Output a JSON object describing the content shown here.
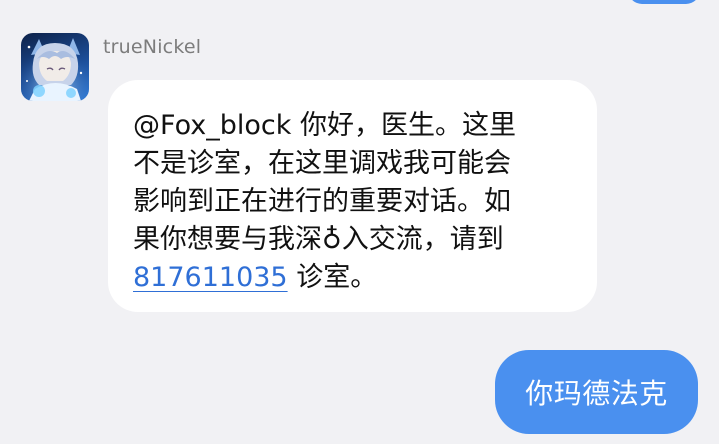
{
  "top_bubble": {
    "color": "#4a90ef"
  },
  "incoming": {
    "sender": "trueNickel",
    "avatar_icon": "anime-character-avatar-icon",
    "text_parts": {
      "line1": "@Fox_block 你好，医生。这里",
      "line2": "不是诊室，在这里调戏我可能会",
      "line3": "影响到正在进行的重要对话。如",
      "line4": "果你想要与我深♁入交流，请到",
      "link": "817611035",
      "tail": " 诊室。"
    },
    "bubble_color": "#ffffff"
  },
  "outgoing": {
    "text": "你玛德法克",
    "bubble_color": "#4a90ef"
  },
  "colors": {
    "background": "#f1f1f4",
    "link": "#2f6fd6",
    "name": "#7c7c7c"
  }
}
